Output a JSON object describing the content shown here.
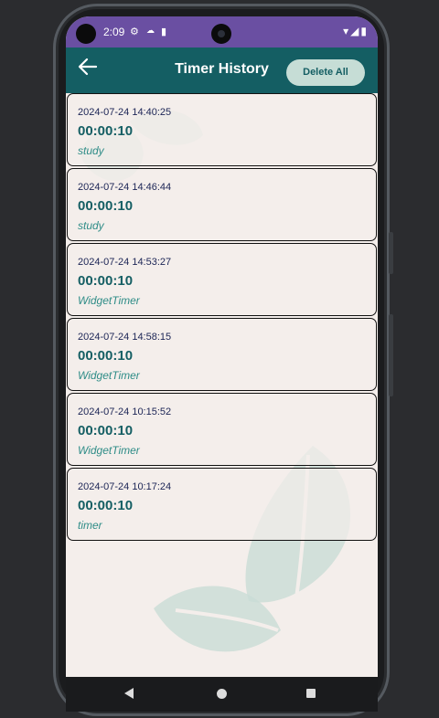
{
  "status_bar": {
    "time": "2:09",
    "icons": [
      "settings-icon",
      "cloud-icon",
      "sim-card-icon"
    ],
    "right_icons": [
      "wifi-icon",
      "signal-icon",
      "battery-icon"
    ]
  },
  "app_bar": {
    "title": "Timer History",
    "delete_all_label": "Delete All"
  },
  "entries": [
    {
      "timestamp": "2024-07-24 14:40:25",
      "duration": "00:00:10",
      "label": "study"
    },
    {
      "timestamp": "2024-07-24 14:46:44",
      "duration": "00:00:10",
      "label": "study"
    },
    {
      "timestamp": "2024-07-24 14:53:27",
      "duration": "00:00:10",
      "label": "WidgetTimer"
    },
    {
      "timestamp": "2024-07-24 14:58:15",
      "duration": "00:00:10",
      "label": "WidgetTimer"
    },
    {
      "timestamp": "2024-07-24 10:15:52",
      "duration": "00:00:10",
      "label": "WidgetTimer"
    },
    {
      "timestamp": "2024-07-24 10:17:24",
      "duration": "00:00:10",
      "label": "timer"
    }
  ],
  "colors": {
    "status_bar": "#6a4fa2",
    "app_bar": "#145e63",
    "background": "#f4eeeb",
    "accent_text": "#2e8c87",
    "leaf": "#c9dcd6"
  }
}
